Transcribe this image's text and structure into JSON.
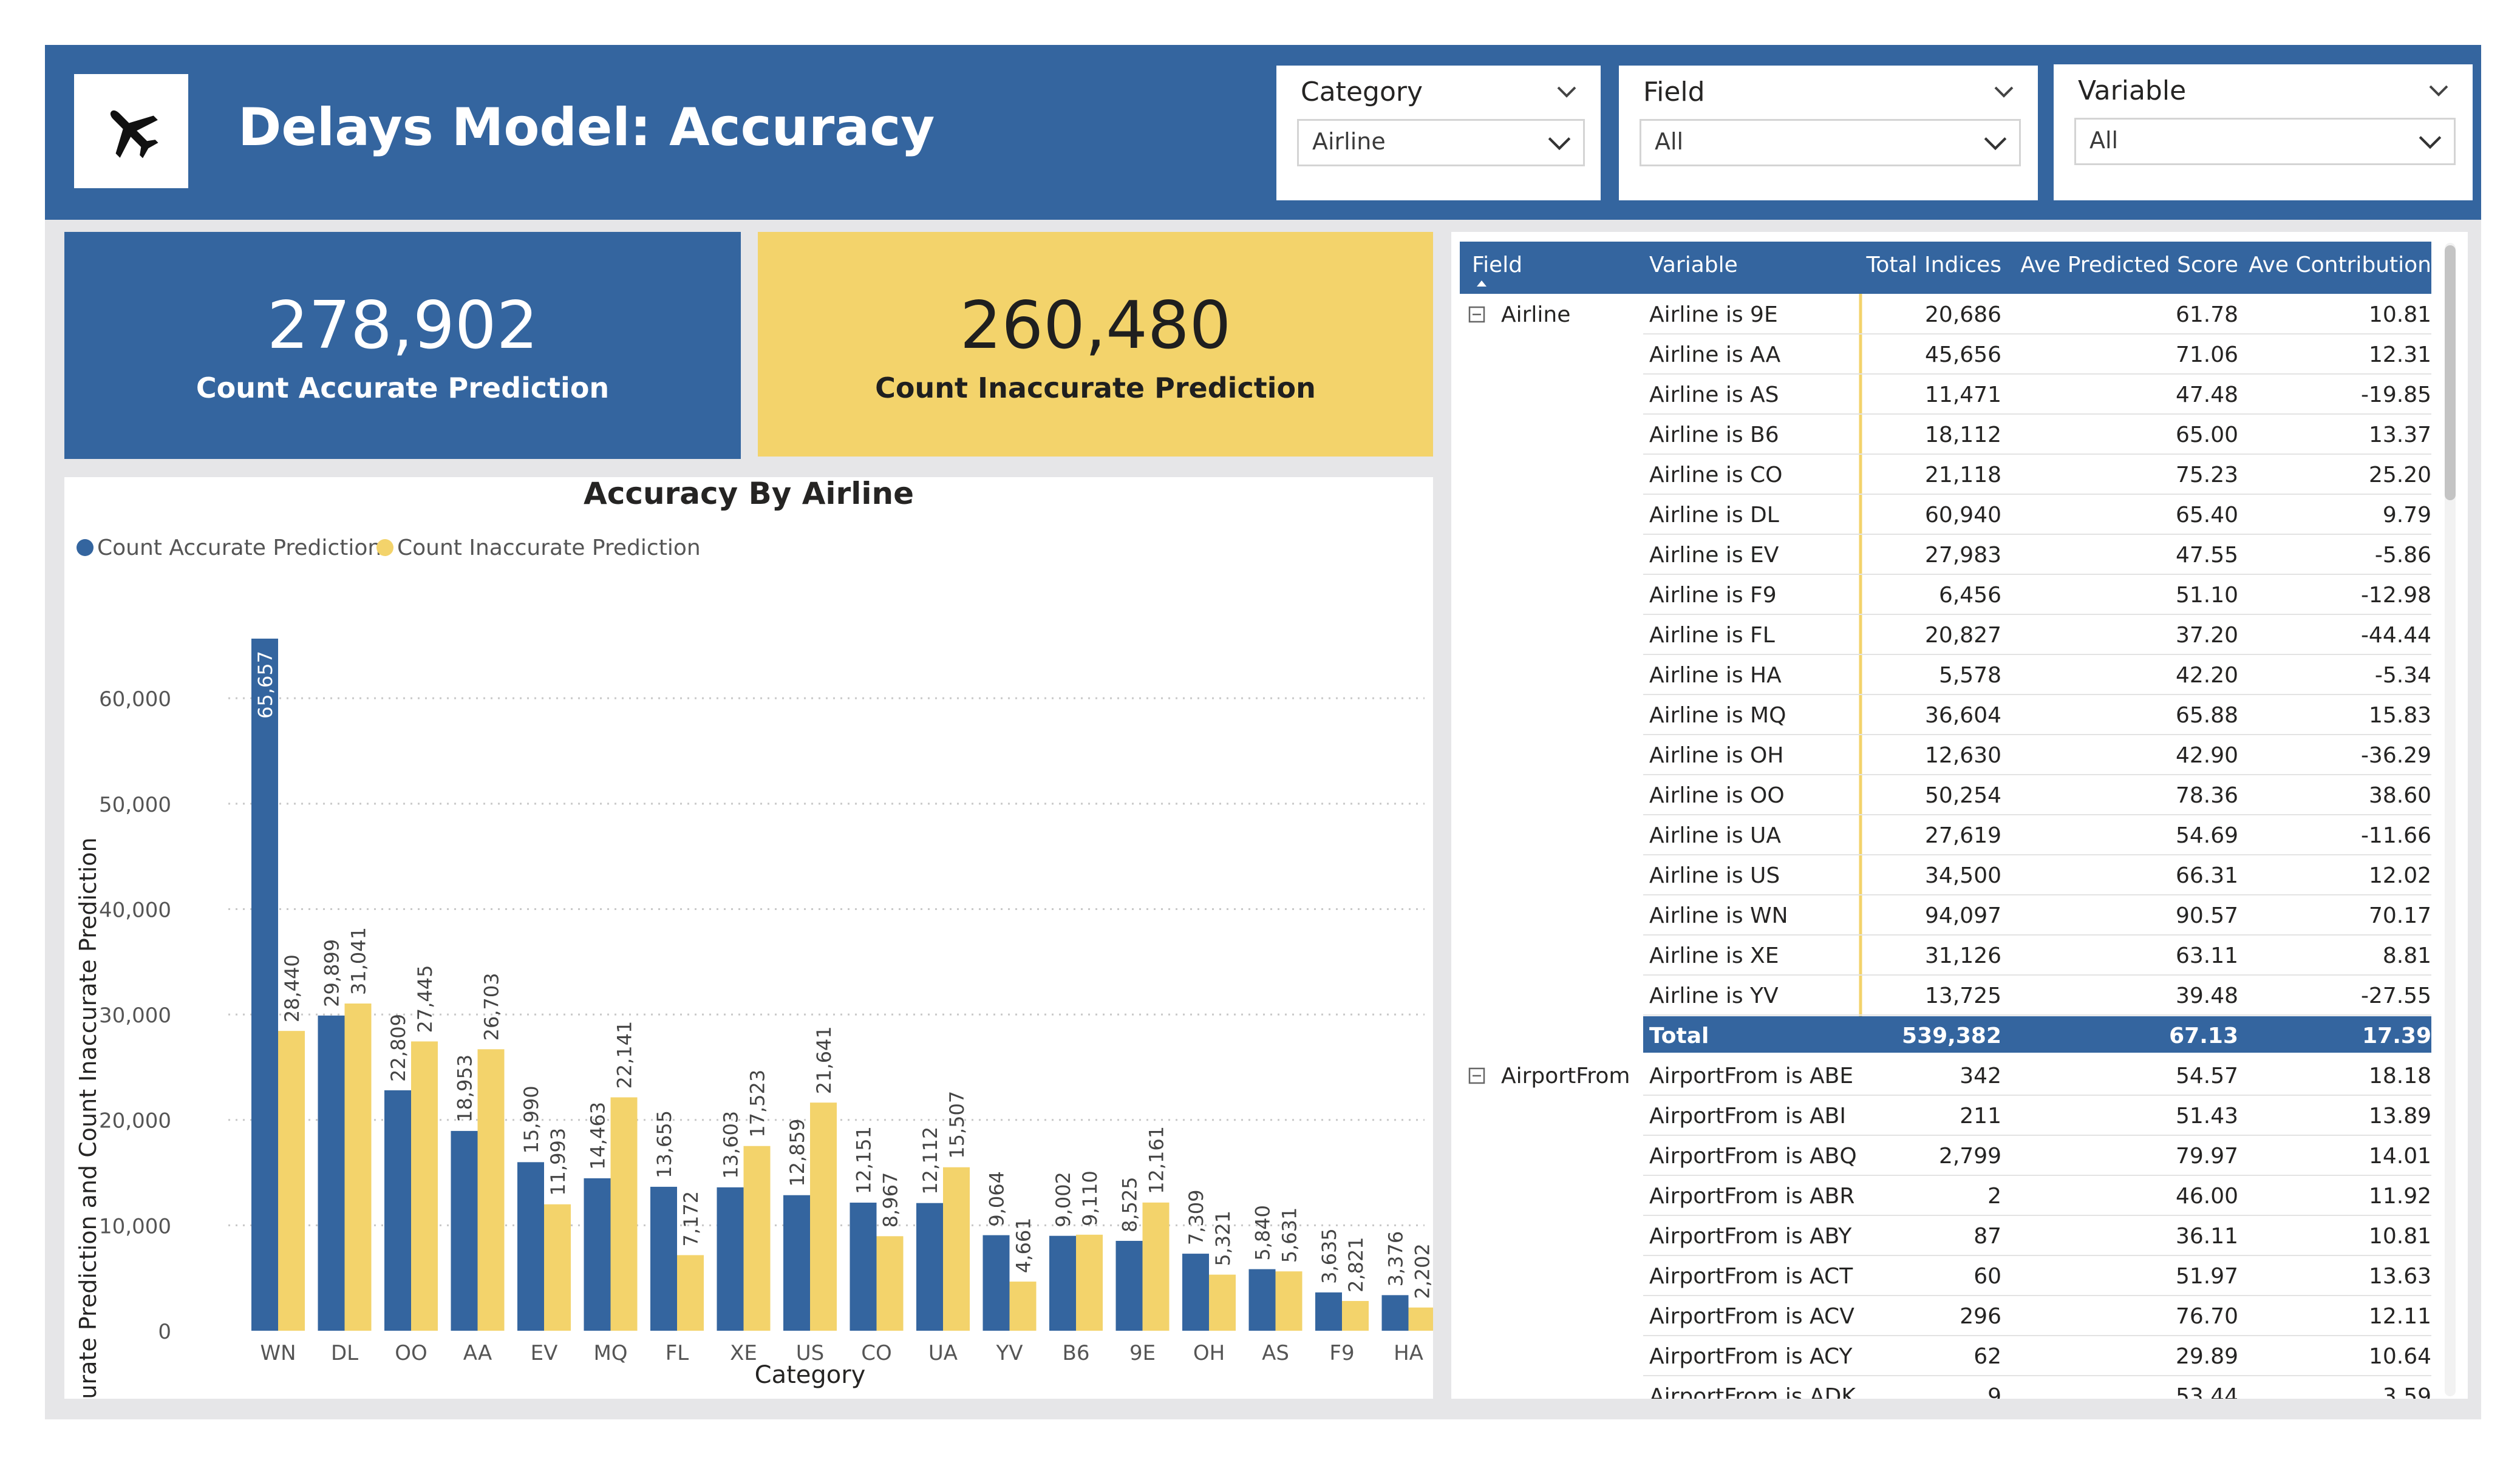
{
  "header": {
    "title": "Delays Model: Accuracy",
    "logo_icon": "airplane-icon",
    "color": "#34659f"
  },
  "filters": [
    {
      "title": "Category",
      "value": "Airline"
    },
    {
      "title": "Field",
      "value": "All"
    },
    {
      "title": "Variable",
      "value": "All"
    }
  ],
  "kpis": {
    "accurate": {
      "value": "278,902",
      "label": "Count Accurate Prediction",
      "color": "#34659f"
    },
    "inaccurate": {
      "value": "260,480",
      "label": "Count Inaccurate Prediction",
      "color": "#f3d36b"
    }
  },
  "chart_data": {
    "type": "bar",
    "title": "Accuracy By Airline",
    "xlabel": "Category",
    "ylabel": "Count Accurate Prediction and Count Inaccurate Prediction",
    "ylim": [
      0,
      66000
    ],
    "yticks": [
      "0",
      "10,000",
      "20,000",
      "30,000",
      "40,000",
      "50,000",
      "60,000"
    ],
    "grid": true,
    "legend_position": "top-left",
    "categories": [
      "WN",
      "DL",
      "OO",
      "AA",
      "EV",
      "MQ",
      "FL",
      "XE",
      "US",
      "CO",
      "UA",
      "YV",
      "B6",
      "9E",
      "OH",
      "AS",
      "F9",
      "HA"
    ],
    "series": [
      {
        "name": "Count Accurate Prediction",
        "color": "#34659f",
        "values": [
          65657,
          29899,
          22809,
          18953,
          15990,
          14463,
          13655,
          13603,
          12859,
          12151,
          12112,
          9064,
          9002,
          8525,
          7309,
          5840,
          3635,
          3376
        ],
        "labels": [
          "65,657",
          "29,899",
          "22,809",
          "18,953",
          "15,990",
          "14,463",
          "13,655",
          "13,603",
          "12,859",
          "12,151",
          "12,112",
          "9,064",
          "9,002",
          "8,525",
          "7,309",
          "5,840",
          "3,635",
          "3,376"
        ]
      },
      {
        "name": "Count Inaccurate Prediction",
        "color": "#f3d36b",
        "values": [
          28440,
          31041,
          27445,
          26703,
          11993,
          22141,
          7172,
          17523,
          21641,
          8967,
          15507,
          4661,
          9110,
          12161,
          5321,
          5631,
          2821,
          2202
        ],
        "labels": [
          "28,440",
          "31,041",
          "27,445",
          "26,703",
          "11,993",
          "22,141",
          "7,172",
          "17,523",
          "21,641",
          "8,967",
          "15,507",
          "4,661",
          "9,110",
          "12,161",
          "5,321",
          "5,631",
          "2,821",
          "2,202"
        ]
      }
    ]
  },
  "table": {
    "columns": [
      "Field",
      "Variable",
      "Total Indices",
      "Ave Predicted Score",
      "Ave Contribution"
    ],
    "header_color": "#34659f",
    "groups": [
      {
        "field": "Airline",
        "rows": [
          [
            "Airline is 9E",
            "20,686",
            "61.78",
            "10.81"
          ],
          [
            "Airline is AA",
            "45,656",
            "71.06",
            "12.31"
          ],
          [
            "Airline is AS",
            "11,471",
            "47.48",
            "-19.85"
          ],
          [
            "Airline is B6",
            "18,112",
            "65.00",
            "13.37"
          ],
          [
            "Airline is CO",
            "21,118",
            "75.23",
            "25.20"
          ],
          [
            "Airline is DL",
            "60,940",
            "65.40",
            "9.79"
          ],
          [
            "Airline is EV",
            "27,983",
            "47.55",
            "-5.86"
          ],
          [
            "Airline is F9",
            "6,456",
            "51.10",
            "-12.98"
          ],
          [
            "Airline is FL",
            "20,827",
            "37.20",
            "-44.44"
          ],
          [
            "Airline is HA",
            "5,578",
            "42.20",
            "-5.34"
          ],
          [
            "Airline is MQ",
            "36,604",
            "65.88",
            "15.83"
          ],
          [
            "Airline is OH",
            "12,630",
            "42.90",
            "-36.29"
          ],
          [
            "Airline is OO",
            "50,254",
            "78.36",
            "38.60"
          ],
          [
            "Airline is UA",
            "27,619",
            "54.69",
            "-11.66"
          ],
          [
            "Airline is US",
            "34,500",
            "66.31",
            "12.02"
          ],
          [
            "Airline is WN",
            "94,097",
            "90.57",
            "70.17"
          ],
          [
            "Airline is XE",
            "31,126",
            "63.11",
            "8.81"
          ],
          [
            "Airline is YV",
            "13,725",
            "39.48",
            "-27.55"
          ]
        ],
        "total": [
          "Total",
          "539,382",
          "67.13",
          "17.39"
        ]
      },
      {
        "field": "AirportFrom",
        "rows": [
          [
            "AirportFrom is ABE",
            "342",
            "54.57",
            "18.18"
          ],
          [
            "AirportFrom is ABI",
            "211",
            "51.43",
            "13.89"
          ],
          [
            "AirportFrom is ABQ",
            "2,799",
            "79.97",
            "14.01"
          ],
          [
            "AirportFrom is ABR",
            "2",
            "46.00",
            "11.92"
          ],
          [
            "AirportFrom is ABY",
            "87",
            "36.11",
            "10.81"
          ],
          [
            "AirportFrom is ACT",
            "60",
            "51.97",
            "13.63"
          ],
          [
            "AirportFrom is ACV",
            "296",
            "76.70",
            "12.11"
          ],
          [
            "AirportFrom is ACY",
            "62",
            "29.89",
            "10.64"
          ],
          [
            "AirportFrom is ADK",
            "9",
            "53.44",
            "3.59"
          ]
        ]
      }
    ]
  }
}
